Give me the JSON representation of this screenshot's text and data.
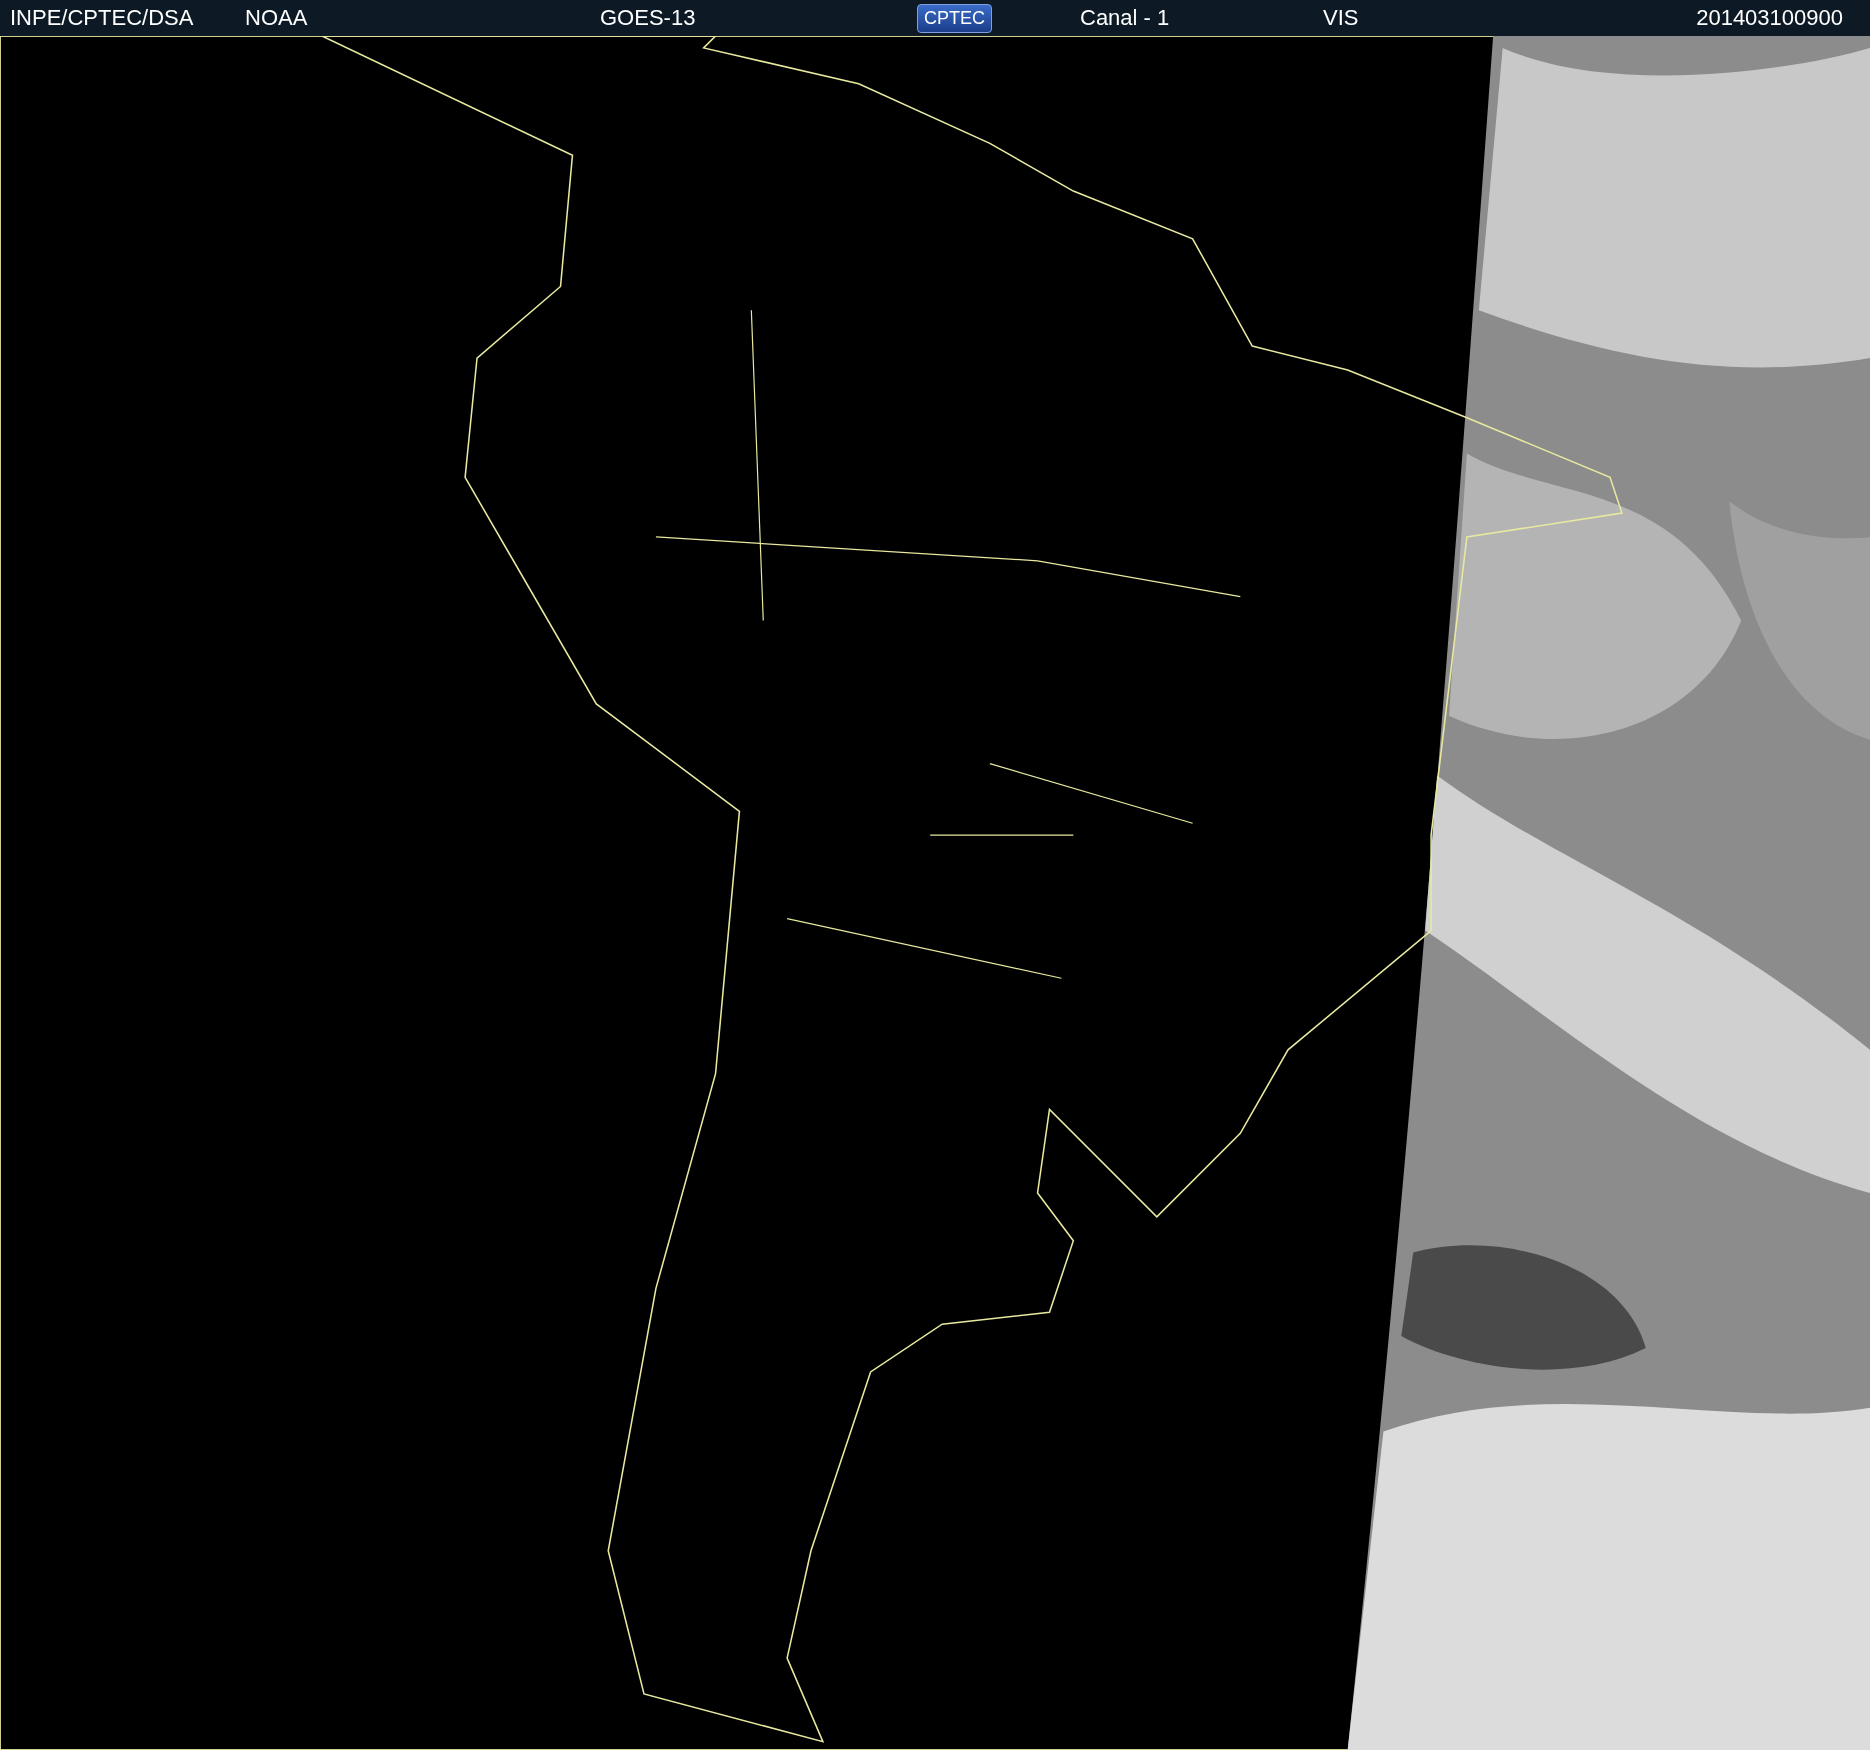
{
  "header": {
    "items": [
      {
        "kind": "text",
        "text": "INPE/CPTEC/DSA"
      },
      {
        "kind": "text",
        "text": "NOAA"
      },
      {
        "kind": "text",
        "text": "GOES-13"
      },
      {
        "kind": "logo",
        "text": "CPTEC"
      },
      {
        "kind": "text",
        "text": "Canal - 1"
      },
      {
        "kind": "text",
        "text": "VIS"
      },
      {
        "kind": "text",
        "text": "201403100900"
      }
    ]
  }
}
